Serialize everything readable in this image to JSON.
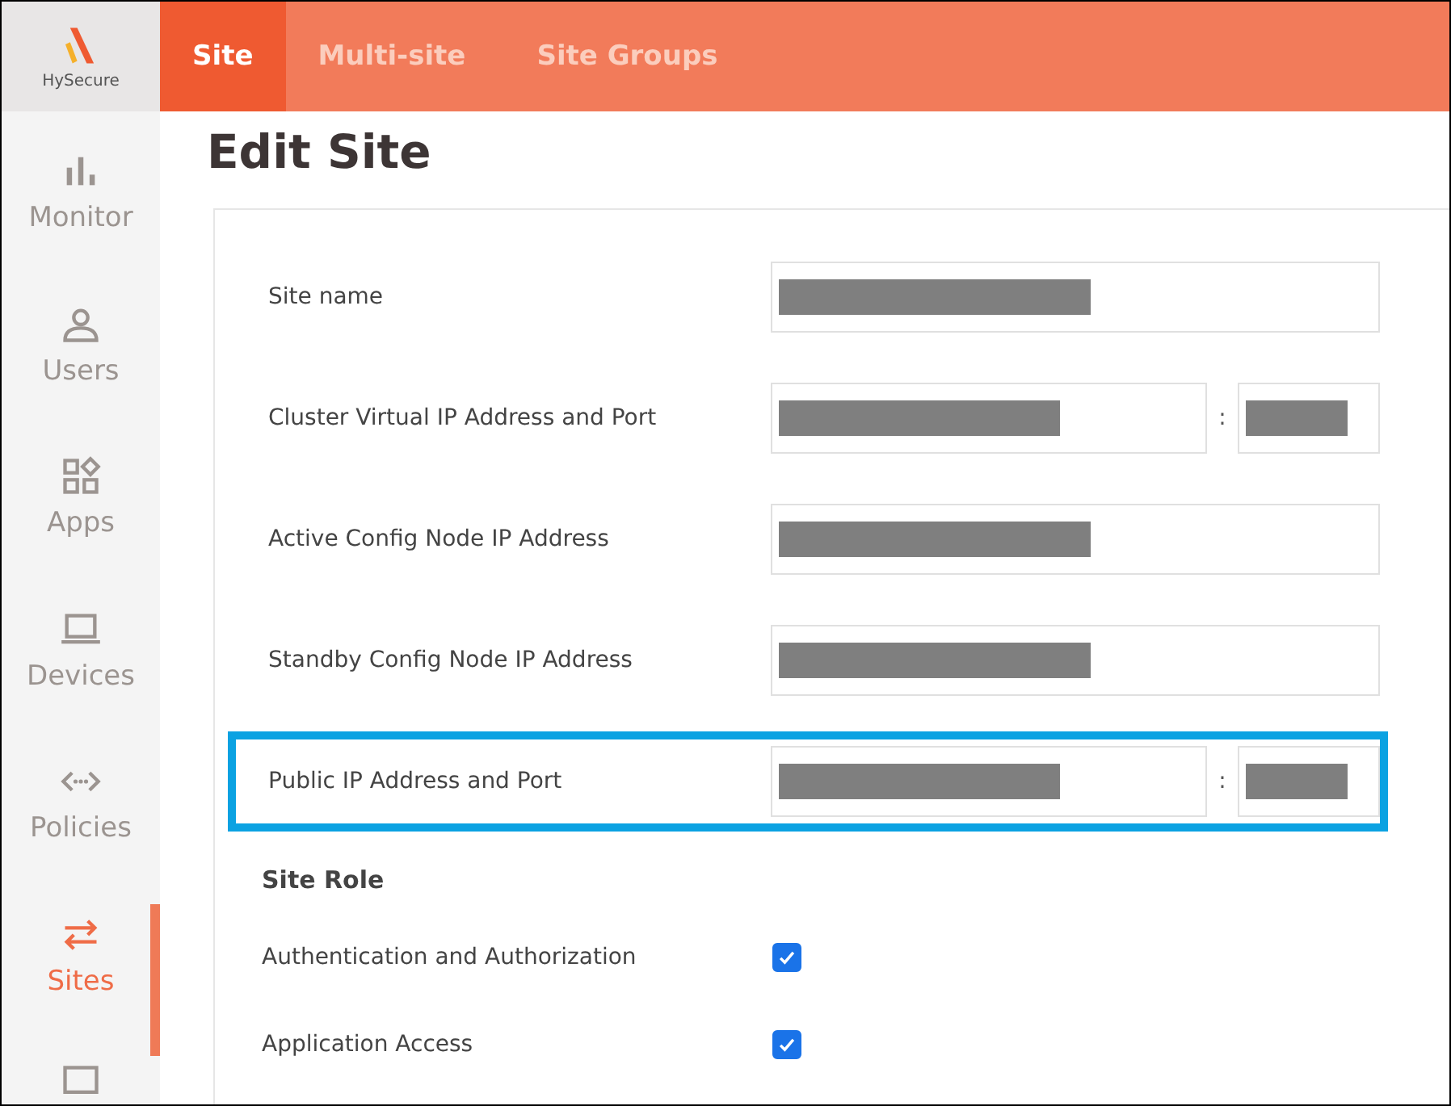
{
  "logo": {
    "text": "HySecure"
  },
  "tabs": [
    {
      "label": "Site",
      "selected": true
    },
    {
      "label": "Multi-site",
      "selected": false
    },
    {
      "label": "Site Groups",
      "selected": false
    }
  ],
  "sidebar": {
    "items": [
      {
        "label": "Monitor",
        "kind": "monitor",
        "selected": false
      },
      {
        "label": "Users",
        "kind": "users",
        "selected": false
      },
      {
        "label": "Apps",
        "kind": "apps",
        "selected": false
      },
      {
        "label": "Devices",
        "kind": "devices",
        "selected": false
      },
      {
        "label": "Policies",
        "kind": "policies",
        "selected": false
      },
      {
        "label": "Sites",
        "kind": "sites",
        "selected": true
      }
    ]
  },
  "page_title": "Edit Site",
  "fields": [
    {
      "label": "Site name",
      "kind": "single",
      "redacted": true,
      "highlighted": false
    },
    {
      "label": "Cluster Virtual IP Address and Port",
      "kind": "port",
      "separator": ":",
      "redacted": true,
      "highlighted": false
    },
    {
      "label": "Active Config Node IP Address",
      "kind": "single",
      "redacted": true,
      "highlighted": false
    },
    {
      "label": "Standby Config Node IP Address",
      "kind": "single",
      "redacted": true,
      "highlighted": false
    },
    {
      "label": "Public IP Address and Port",
      "kind": "port",
      "separator": ":",
      "redacted": true,
      "highlighted": true
    }
  ],
  "site_role": {
    "heading": "Site Role",
    "options": [
      {
        "label": "Authentication and Authorization",
        "checked": true
      },
      {
        "label": "Application Access",
        "checked": true
      }
    ]
  }
}
